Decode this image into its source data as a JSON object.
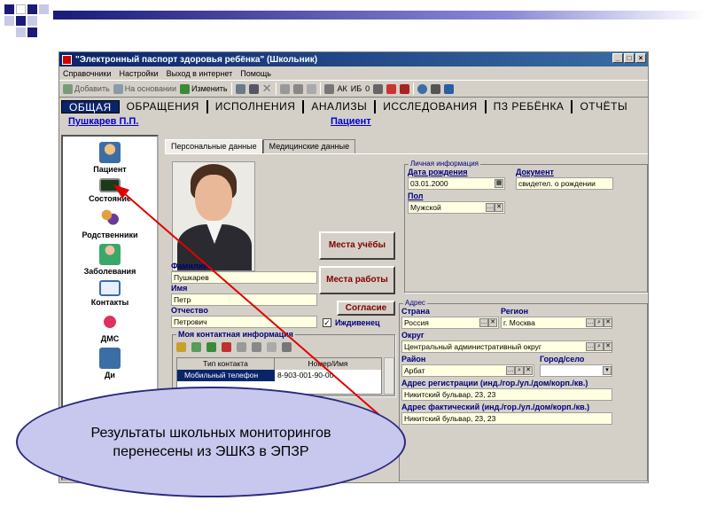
{
  "window": {
    "title": "\"Электронный паспорт здоровья ребёнка\" (Школьник)",
    "btn_min": "_",
    "btn_max": "□",
    "btn_close": "×"
  },
  "menu": [
    "Справочники",
    "Настройки",
    "Выход в интернет",
    "Помощь"
  ],
  "toolbar": {
    "add": "Добавить",
    "based_on": "На основании",
    "edit": "Изменить",
    "ak": "АК",
    "ib": "ИБ",
    "zero": "0"
  },
  "tabs": [
    "ОБЩАЯ",
    "ОБРАЩЕНИЯ",
    "ИСПОЛНЕНИЯ",
    "АНАЛИЗЫ",
    "ИССЛЕДОВАНИЯ",
    "ПЗ РЕБЁНКА",
    "ОТЧЁТЫ"
  ],
  "userbar": {
    "user": "Пушкарев П.П.",
    "section": "Пациент"
  },
  "sidebar": [
    "Пациент",
    "Состояние",
    "Родственники",
    "Заболевания",
    "Контакты",
    "ДМС",
    "Ди"
  ],
  "panel_tabs": [
    "Персональные данные",
    "Медицинские данные"
  ],
  "person": {
    "surname_label": "Фамилия",
    "surname": "Пушкарев",
    "name_label": "Имя",
    "name": "Петр",
    "patronymic_label": "Отчество",
    "patronymic": "Петрович",
    "dependent_label": "Иждивенец"
  },
  "buttons": {
    "study_places": "Места учёбы",
    "work_places": "Места работы",
    "consent": "Согласие"
  },
  "contacts": {
    "title": "Моя контактная информация",
    "col_type": "Тип контакта",
    "col_number": "Номер/Имя",
    "row_type": "Мобильный телефон",
    "row_number": "8-903-001-90-00"
  },
  "personal_info": {
    "title": "Личная информация",
    "birth_label": "Дата рождения",
    "birth": "03.01.2000",
    "doc_label": "Документ",
    "doc": "свидетел. о рождении",
    "sex_label": "Пол",
    "sex": "Мужской"
  },
  "address": {
    "title": "Адрес",
    "country_label": "Страна",
    "country": "Россия",
    "region_label": "Регион",
    "region": "г. Москва",
    "okrug_label": "Округ",
    "okrug": "Центральный административный округ",
    "district_label": "Район",
    "district": "Арбат",
    "city_label": "Город/село",
    "reg_label": "Адрес регистрации (инд./гор./ул./дом/корп./кв.)",
    "reg": "Никитский бульвар, 23, 23",
    "fact_label": "Адрес фактический (инд./гор./ул./дом/корп./кв.)",
    "fact": "Никитский бульвар, 23, 23"
  },
  "callout": {
    "line1": "Результаты школьных мониторингов",
    "line2": "перенесены из ЭШКЗ в ЭПЗР"
  },
  "colors": {
    "title_bar": "#0a246a",
    "label_blue": "#00007a",
    "button_text": "#800000",
    "callout_fill": "#c8c8ee",
    "arrow": "#e00000"
  }
}
